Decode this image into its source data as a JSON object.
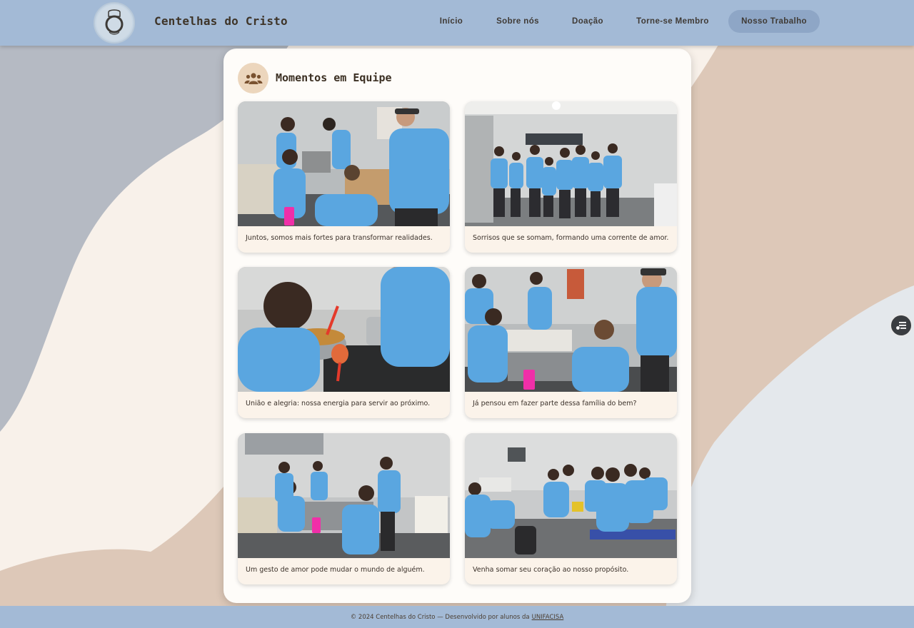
{
  "header": {
    "brand": "Centelhas do Cristo",
    "nav": [
      {
        "label": "Início",
        "active": false
      },
      {
        "label": "Sobre nós",
        "active": false
      },
      {
        "label": "Doação",
        "active": false
      },
      {
        "label": "Torne-se Membro",
        "active": false
      },
      {
        "label": "Nosso Trabalho",
        "active": true
      }
    ]
  },
  "section": {
    "title": "Momentos em Equipe",
    "icon": "users-icon"
  },
  "gallery": [
    {
      "caption": "Juntos, somos mais fortes para transformar realidades."
    },
    {
      "caption": "Sorrisos que se somam, formando uma corrente de amor."
    },
    {
      "caption": "União e alegria: nossa energia para servir ao próximo."
    },
    {
      "caption": "Já pensou em fazer parte dessa família do bem?"
    },
    {
      "caption": "Um gesto de amor pode mudar o mundo de alguém."
    },
    {
      "caption": "Venha somar seu coração ao nosso propósito."
    }
  ],
  "footer": {
    "text": "© 2024 Centelhas do Cristo — Desenvolvido por alunos da",
    "link": "UNIFACISA"
  },
  "colors": {
    "header_bg": "#a3bad6",
    "accent": "#ecd6bd",
    "shirt_blue": "#5aa6e0"
  }
}
